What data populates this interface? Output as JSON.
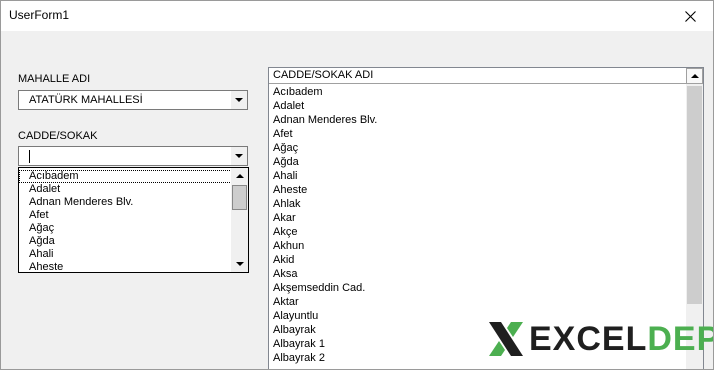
{
  "window": {
    "title": "UserForm1"
  },
  "mahalle": {
    "label": "MAHALLE ADI",
    "value": "ATATÜRK MAHALLESİ"
  },
  "cadde": {
    "label": "CADDE/SOKAK",
    "value": "",
    "dropdown_items": [
      "Acıbadem",
      "Adalet",
      "Adnan Menderes Blv.",
      "Afet",
      "Ağaç",
      "Ağda",
      "Ahali",
      "Aheste"
    ]
  },
  "listbox": {
    "header": "CADDE/SOKAK ADI",
    "items": [
      "Acıbadem",
      "Adalet",
      "Adnan Menderes Blv.",
      "Afet",
      "Ağaç",
      "Ağda",
      "Ahali",
      "Aheste",
      "Ahlak",
      "Akar",
      "Akçe",
      "Akhun",
      "Akid",
      "Aksa",
      "Akşemseddin Cad.",
      "Aktar",
      "Alayuntlu",
      "Albayrak",
      "Albayrak 1",
      "Albayrak 2"
    ]
  },
  "logo": {
    "part1": "EXCEL",
    "part2": "DEPO"
  },
  "colors": {
    "logo_green": "#4caf50",
    "logo_dark": "#1f1f1f"
  }
}
